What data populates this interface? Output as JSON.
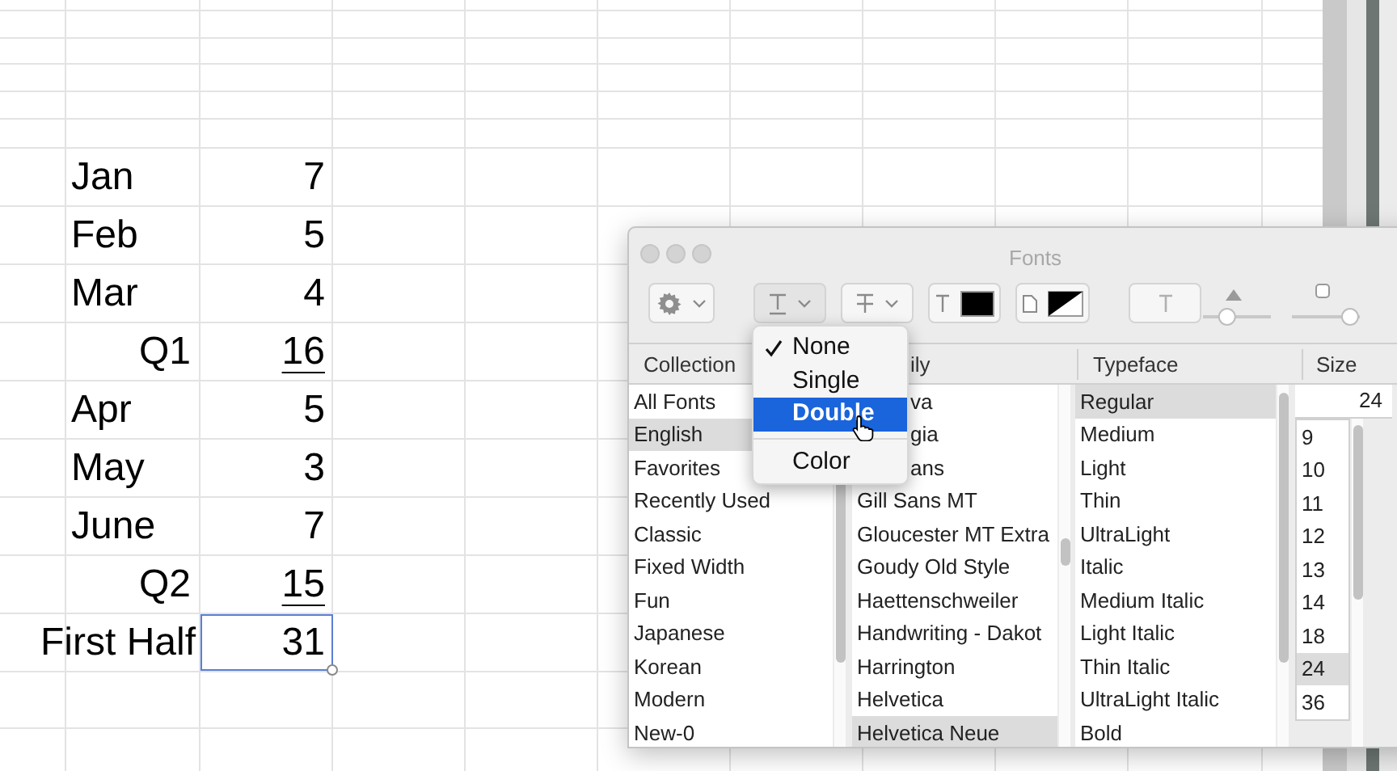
{
  "sheet": {
    "rows": [
      {
        "kind": "month",
        "label": "Jan",
        "value": "7",
        "selected": false
      },
      {
        "kind": "month",
        "label": "Feb",
        "value": "5",
        "selected": false
      },
      {
        "kind": "month",
        "label": "Mar",
        "value": "4",
        "selected": false
      },
      {
        "kind": "subtotal",
        "label": "Q1",
        "value": "16",
        "selected": false
      },
      {
        "kind": "month",
        "label": "Apr",
        "value": "5",
        "selected": false
      },
      {
        "kind": "month",
        "label": "May",
        "value": "3",
        "selected": false
      },
      {
        "kind": "month",
        "label": "June",
        "value": "7",
        "selected": false
      },
      {
        "kind": "subtotal",
        "label": "Q2",
        "value": "15",
        "selected": false
      },
      {
        "kind": "total",
        "label": "First Half",
        "value": "31",
        "selected": true
      }
    ]
  },
  "fonts_panel": {
    "title": "Fonts",
    "shadow_opacity": {
      "level": 0.32
    },
    "shadow_blur": {
      "level": 0.94
    },
    "underline_menu": [
      {
        "kind": "item",
        "label": "None",
        "checked": true,
        "selected": false
      },
      {
        "kind": "item",
        "label": "Single",
        "checked": false,
        "selected": false
      },
      {
        "kind": "item",
        "label": "Double",
        "checked": false,
        "selected": true
      },
      {
        "kind": "separator"
      },
      {
        "kind": "item",
        "label": "Color",
        "checked": false,
        "selected": false
      }
    ],
    "collection": {
      "header": "Collection",
      "items": [
        {
          "label": "All Fonts",
          "selected": false
        },
        {
          "label": "English",
          "selected": true
        },
        {
          "label": "Favorites",
          "selected": false
        },
        {
          "label": "Recently Used",
          "selected": false
        },
        {
          "label": "Classic",
          "selected": false
        },
        {
          "label": "Fixed Width",
          "selected": false
        },
        {
          "label": "Fun",
          "selected": false
        },
        {
          "label": "Japanese",
          "selected": false
        },
        {
          "label": "Korean",
          "selected": false
        },
        {
          "label": "Modern",
          "selected": false
        },
        {
          "label": "New-0",
          "selected": false
        }
      ]
    },
    "family": {
      "header": "ily",
      "items": [
        {
          "kind": "clipped",
          "label": "va",
          "selected": false
        },
        {
          "kind": "clipped",
          "label": "gia",
          "selected": false
        },
        {
          "kind": "clipped",
          "label": "ans",
          "selected": false
        },
        {
          "kind": "full",
          "label": "Gill Sans MT",
          "selected": false
        },
        {
          "kind": "full",
          "label": "Gloucester MT Extra",
          "selected": false
        },
        {
          "kind": "full",
          "label": "Goudy Old Style",
          "selected": false
        },
        {
          "kind": "full",
          "label": "Haettenschweiler",
          "selected": false
        },
        {
          "kind": "full",
          "label": "Handwriting - Dakot",
          "selected": false
        },
        {
          "kind": "full",
          "label": "Harrington",
          "selected": false
        },
        {
          "kind": "full",
          "label": "Helvetica",
          "selected": false
        },
        {
          "kind": "full",
          "label": "Helvetica Neue",
          "selected": true
        }
      ]
    },
    "typeface": {
      "header": "Typeface",
      "items": [
        {
          "label": "Regular",
          "selected": true
        },
        {
          "label": "Medium",
          "selected": false
        },
        {
          "label": "Light",
          "selected": false
        },
        {
          "label": "Thin",
          "selected": false
        },
        {
          "label": "UltraLight",
          "selected": false
        },
        {
          "label": "Italic",
          "selected": false
        },
        {
          "label": "Medium Italic",
          "selected": false
        },
        {
          "label": "Light Italic",
          "selected": false
        },
        {
          "label": "Thin Italic",
          "selected": false
        },
        {
          "label": "UltraLight Italic",
          "selected": false
        },
        {
          "label": "Bold",
          "selected": false
        }
      ]
    },
    "size": {
      "header": "Size",
      "value": "24",
      "items": [
        {
          "label": "9",
          "selected": false
        },
        {
          "label": "10",
          "selected": false
        },
        {
          "label": "11",
          "selected": false
        },
        {
          "label": "12",
          "selected": false
        },
        {
          "label": "13",
          "selected": false
        },
        {
          "label": "14",
          "selected": false
        },
        {
          "label": "18",
          "selected": false
        },
        {
          "label": "24",
          "selected": true
        },
        {
          "label": "36",
          "selected": false
        }
      ]
    }
  }
}
